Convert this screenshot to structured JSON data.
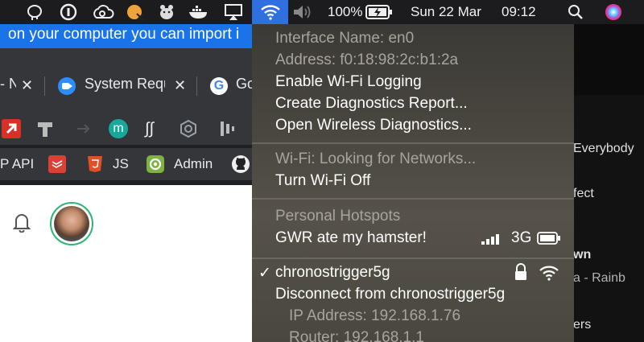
{
  "menubar": {
    "battery_percent": "100%",
    "date": "Sun 22 Mar",
    "time": "09:12",
    "icons": [
      "postgres-elephant-icon",
      "one-password-icon",
      "creative-cloud-icon",
      "macos-app-badge-icon",
      "hamster-icon",
      "docker-whale-icon",
      "airplay-icon",
      "wifi-icon",
      "speaker-icon",
      "battery-charging-icon",
      "spotlight-search-icon",
      "siri-icon"
    ]
  },
  "browser": {
    "banner_text": "on your computer you can import i",
    "tabs": [
      {
        "label": "- N",
        "icon": "tab-icon"
      },
      {
        "label": "System Requ",
        "icon": "zoom-icon"
      },
      {
        "label": "Go",
        "icon": "google-icon"
      }
    ],
    "bookmarks": [
      {
        "label": "P API"
      },
      {
        "label": "",
        "icon": "todoist-icon"
      },
      {
        "label": "JS",
        "icon": "html5-icon"
      },
      {
        "label": "Admin",
        "icon": "admin-icon"
      },
      {
        "label": "",
        "icon": "github-icon"
      }
    ]
  },
  "right_panel": {
    "items": [
      "Everybody",
      "fect",
      "wn",
      "a - Rainb",
      "ers"
    ]
  },
  "wifi_menu": {
    "interface_name": "Interface Name: en0",
    "address": "Address: f0:18:98:2c:b1:2a",
    "enable_logging": "Enable Wi-Fi Logging",
    "create_report": "Create Diagnostics Report...",
    "open_diagnostics": "Open Wireless Diagnostics...",
    "status": "Wi-Fi: Looking for Networks...",
    "turn_off": "Turn Wi-Fi Off",
    "hotspots_header": "Personal Hotspots",
    "hotspot_name": "GWR ate my hamster!",
    "hotspot_network": "3G",
    "connected_network": "chronostrigger5g",
    "check_glyph": "✓",
    "disconnect": "Disconnect from chronostrigger5g",
    "ip_address": "IP Address: 192.168.1.76",
    "router": "Router: 192.168.1.1"
  }
}
